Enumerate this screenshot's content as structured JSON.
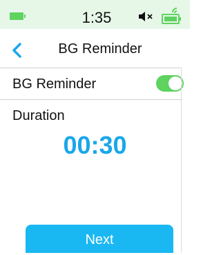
{
  "status_bar": {
    "time": "1:35",
    "icons": [
      "battery-icon",
      "mute-icon",
      "bluetooth-battery-icon"
    ],
    "colors": {
      "background": "#e6f7e8",
      "battery": "#5fd35f"
    }
  },
  "nav": {
    "back_icon": "back-chevron-icon",
    "title": "BG Reminder"
  },
  "settings": {
    "reminder_label": "BG Reminder",
    "reminder_enabled": true,
    "duration_label": "Duration",
    "duration_value": "00:30"
  },
  "actions": {
    "next_label": "Next"
  },
  "colors": {
    "accent": "#1aa7ea",
    "button": "#1ab8f2",
    "toggle_on": "#5fd35f"
  }
}
